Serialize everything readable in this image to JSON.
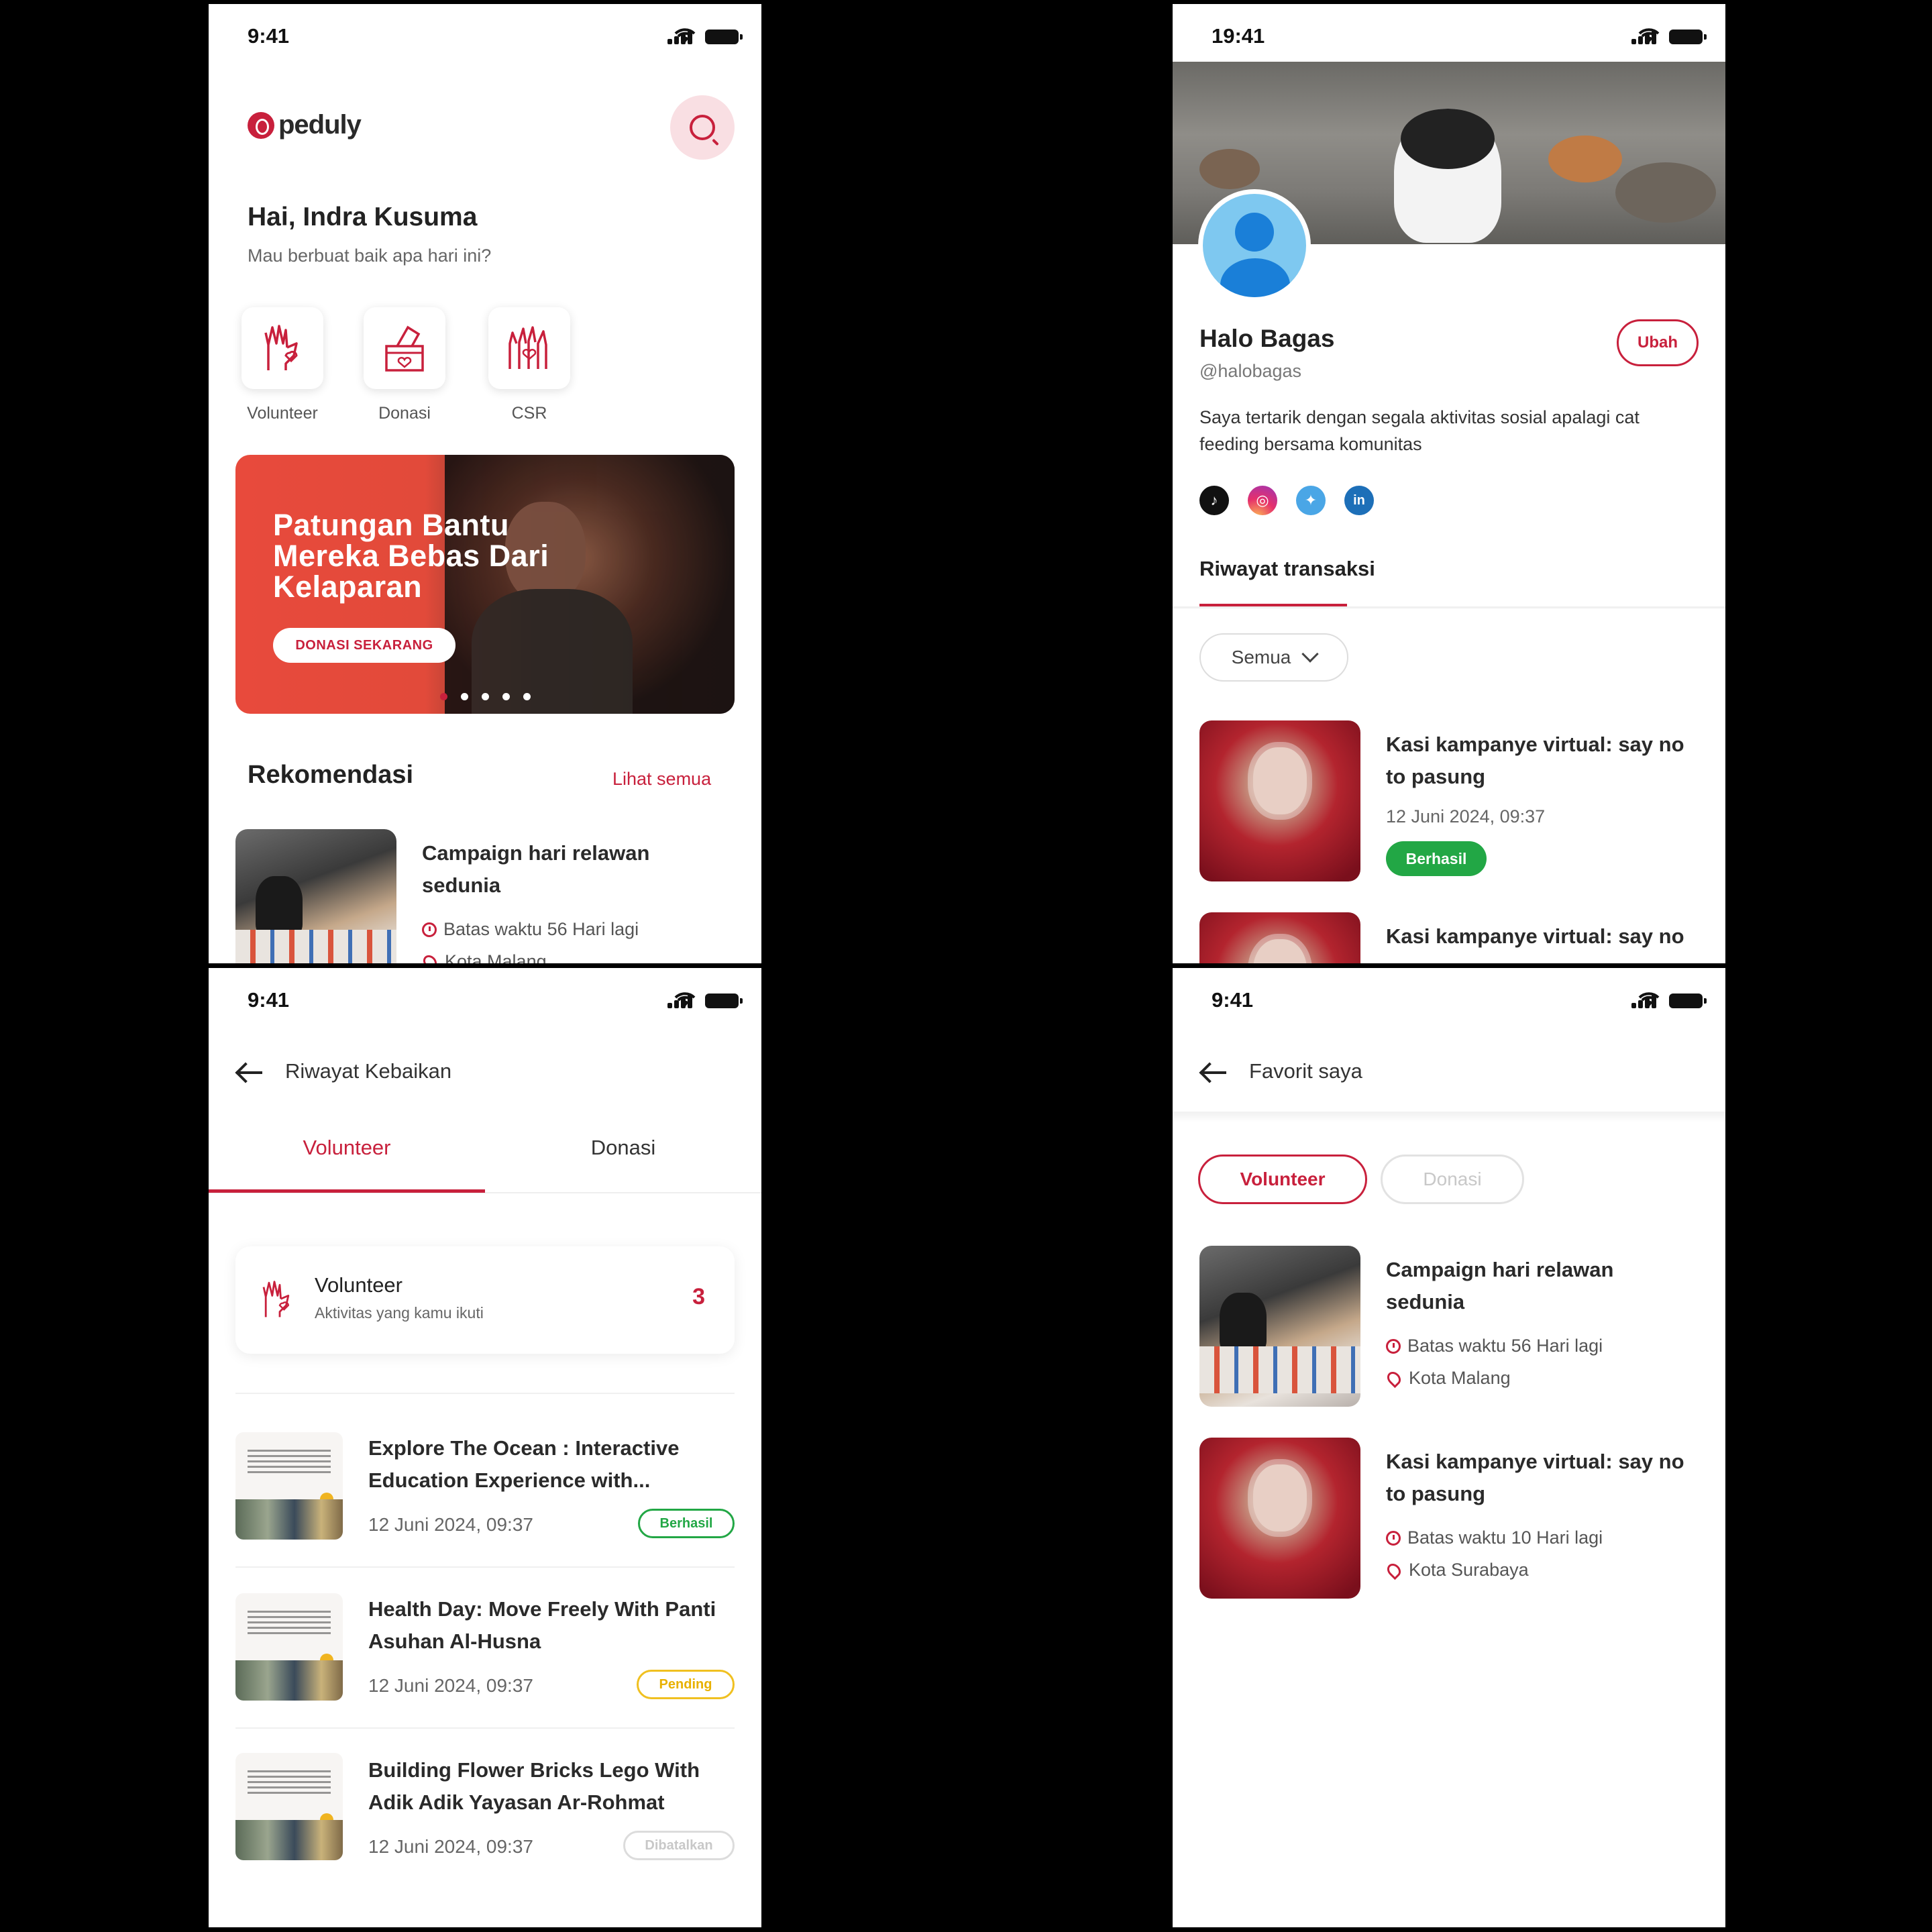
{
  "home": {
    "time": "9:41",
    "logo": "peduly",
    "greeting": "Hai, Indra Kusuma",
    "subgreeting": "Mau berbuat baik apa hari ini?",
    "categories": [
      {
        "label": "Volunteer",
        "icon": "volunteer-hand-icon"
      },
      {
        "label": "Donasi",
        "icon": "donation-box-icon"
      },
      {
        "label": "CSR",
        "icon": "csr-hands-icon"
      }
    ],
    "banner": {
      "title": "Patungan Bantu Mereka Bebas Dari Kelaparan",
      "cta": "DONASI SEKARANG",
      "slides": 5,
      "active_slide": 1
    },
    "section_title": "Rekomendasi",
    "see_all": "Lihat semua",
    "card": {
      "title": "Campaign hari relawan sedunia",
      "deadline": "Batas waktu 56 Hari lagi",
      "location": "Kota Malang"
    }
  },
  "profile": {
    "time": "19:41",
    "name": "Halo Bagas",
    "handle": "@halobagas",
    "edit_button": "Ubah",
    "bio": "Saya tertarik dengan segala aktivitas sosial apalagi cat feeding bersama komunitas",
    "socials": [
      "tiktok-icon",
      "instagram-icon",
      "twitter-icon",
      "linkedin-icon"
    ],
    "tab": "Riwayat transaksi",
    "filter": "Semua",
    "transactions": [
      {
        "title": "Kasi kampanye virtual: say no to pasung",
        "date": "12 Juni 2024, 09:37",
        "status": "Berhasil"
      },
      {
        "title": "Kasi kampanye virtual: say no"
      }
    ]
  },
  "history": {
    "time": "9:41",
    "title": "Riwayat Kebaikan",
    "tabs": [
      "Volunteer",
      "Donasi"
    ],
    "summary": {
      "title": "Volunteer",
      "subtitle": "Aktivitas yang kamu ikuti",
      "count": "3"
    },
    "items": [
      {
        "title": "Explore The Ocean : Interactive Education Experience with...",
        "date": "12 Juni 2024, 09:37",
        "status": "Berhasil"
      },
      {
        "title": "Health Day: Move Freely With Panti Asuhan Al-Husna",
        "date": "12 Juni 2024, 09:37",
        "status": "Pending"
      },
      {
        "title": "Building Flower Bricks Lego With Adik Adik Yayasan Ar-Rohmat",
        "date": "12 Juni 2024, 09:37",
        "status": "Dibatalkan"
      }
    ]
  },
  "favorites": {
    "time": "9:41",
    "title": "Favorit saya",
    "filters": [
      "Volunteer",
      "Donasi"
    ],
    "items": [
      {
        "title": "Campaign hari relawan sedunia",
        "deadline": "Batas waktu 56 Hari lagi",
        "location": "Kota Malang"
      },
      {
        "title": "Kasi kampanye virtual: say no to pasung",
        "deadline": "Batas waktu 10 Hari lagi",
        "location": "Kota Surabaya"
      }
    ]
  },
  "colors": {
    "accent": "#c8203c",
    "success": "#22a745",
    "pending": "#f0c020"
  }
}
